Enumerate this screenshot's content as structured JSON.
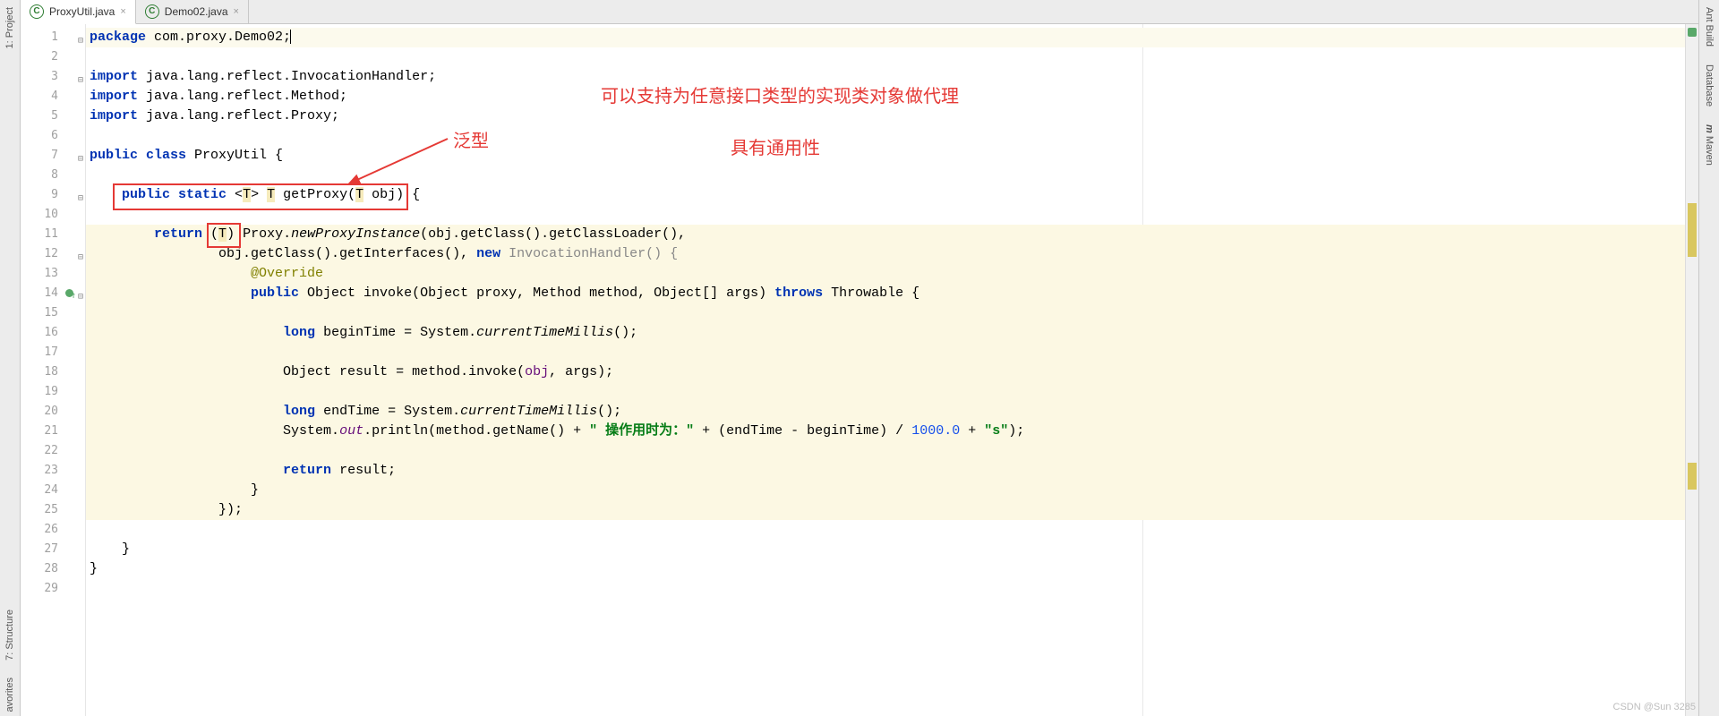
{
  "left_tools": {
    "project": "1: Project",
    "structure": "7: Structure",
    "favorites": "avorites"
  },
  "right_tools": {
    "ant": "Ant Build",
    "database": "Database",
    "maven": "Maven"
  },
  "tabs": [
    {
      "label": "ProxyUtil.java",
      "active": true
    },
    {
      "label": "Demo02.java",
      "active": false
    }
  ],
  "annotations": {
    "generic": "泛型",
    "support": "可以支持为任意接口类型的实现类对象做代理",
    "universal": "具有通用性"
  },
  "watermark": "CSDN @Sun 3285",
  "code": {
    "l1": {
      "a": "package ",
      "b": "com.proxy.Demo02;"
    },
    "l3": {
      "a": "import ",
      "b": "java.lang.reflect.InvocationHandler;"
    },
    "l4": {
      "a": "import ",
      "b": "java.lang.reflect.Method;"
    },
    "l5": {
      "a": "import ",
      "b": "java.lang.reflect.Proxy;"
    },
    "l7": {
      "a": "public class ",
      "b": "ProxyUtil {"
    },
    "l9": {
      "a": "public static ",
      "b": "<",
      "c": "T",
      "d": "> ",
      "e": "T",
      "f": " getProxy(",
      "g": "T",
      "h": " obj)",
      "i": " {"
    },
    "l11": {
      "a": "return ",
      "b": "(",
      "c": "T",
      "d": ") ",
      "e": "Proxy.",
      "f": "newProxyInstance",
      "g": "(obj.getClass().getClassLoader(),"
    },
    "l12": {
      "a": "obj.getClass().getInterfaces(), ",
      "b": "new ",
      "c": "InvocationHandler() {"
    },
    "l13": {
      "a": "@Override"
    },
    "l14": {
      "a": "public ",
      "b": "Object invoke(Object proxy, Method method, Object[] args) ",
      "c": "throws ",
      "d": "Throwable {"
    },
    "l16": {
      "a": "long ",
      "b": "beginTime = System.",
      "c": "currentTimeMillis",
      "d": "();"
    },
    "l18": {
      "a": "Object result = method.invoke(",
      "b": "obj",
      "c": ", args);"
    },
    "l20": {
      "a": "long ",
      "b": "endTime = System.",
      "c": "currentTimeMillis",
      "d": "();"
    },
    "l21": {
      "a": "System.",
      "b": "out",
      "c": ".println(method.getName() + ",
      "d": "\" 操作用时为：\"",
      "e": " + (endTime - beginTime) / ",
      "f": "1000.0",
      "g": " + ",
      "h": "\"s\"",
      "i": ");"
    },
    "l23": {
      "a": "return ",
      "b": "result;"
    },
    "l24": {
      "a": "}"
    },
    "l25": {
      "a": "});"
    },
    "l27": {
      "a": "}"
    },
    "l28": {
      "a": "}"
    }
  },
  "line_count": 29
}
